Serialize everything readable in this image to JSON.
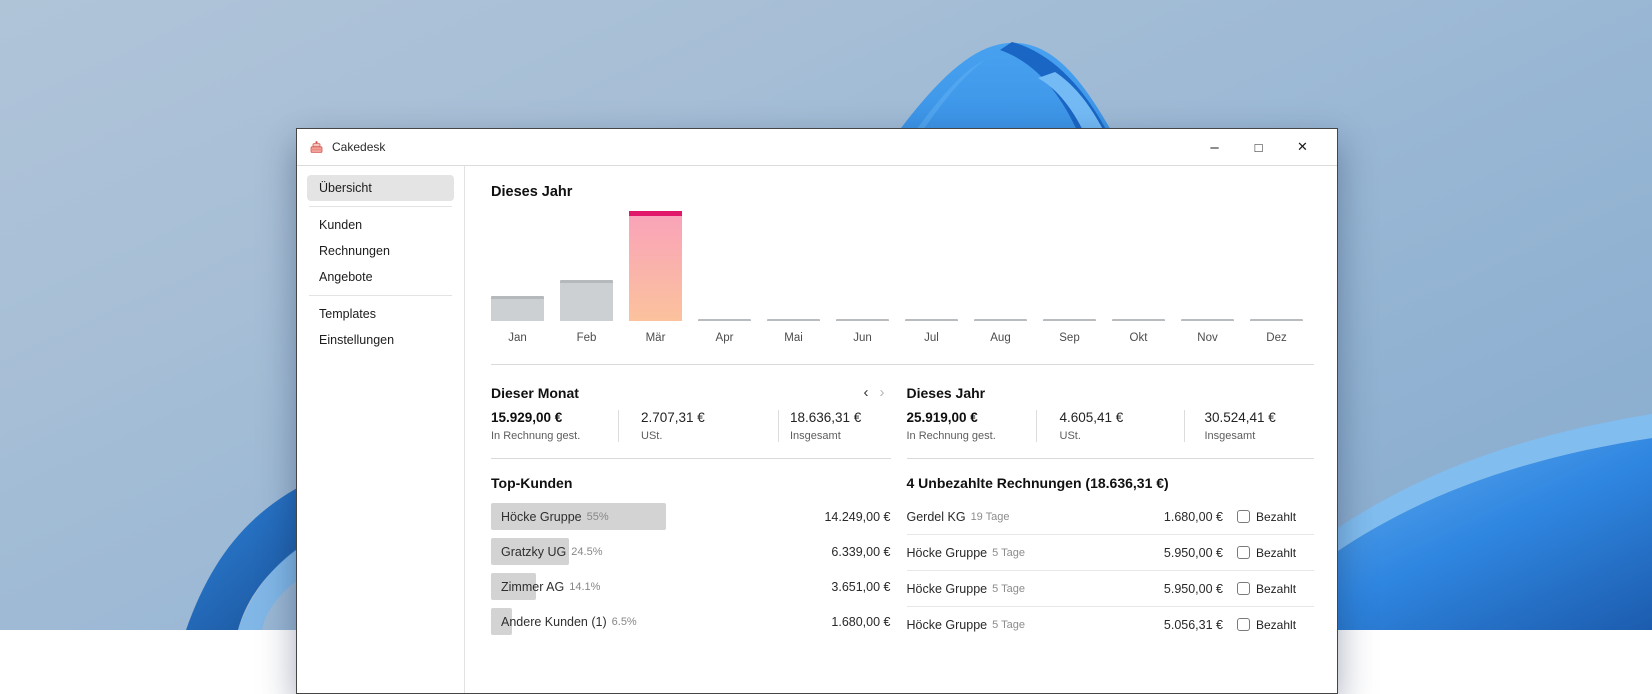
{
  "window": {
    "title": "Cakedesk",
    "controls": {
      "minimize": "–",
      "maximize": "□",
      "close": "✕"
    }
  },
  "sidebar": {
    "items": [
      {
        "label": "Übersicht",
        "active": true
      },
      {
        "label": "Kunden",
        "active": false
      },
      {
        "label": "Rechnungen",
        "active": false
      },
      {
        "label": "Angebote",
        "active": false
      },
      {
        "label": "Templates",
        "active": false
      },
      {
        "label": "Einstellungen",
        "active": false
      }
    ]
  },
  "chart_data": {
    "type": "bar",
    "title": "Dieses Jahr",
    "categories": [
      "Jan",
      "Feb",
      "Mär",
      "Apr",
      "Mai",
      "Jun",
      "Jul",
      "Aug",
      "Sep",
      "Okt",
      "Nov",
      "Dez"
    ],
    "values": [
      3600,
      5900,
      15929,
      0,
      0,
      0,
      0,
      0,
      0,
      0,
      0,
      0
    ],
    "values_estimated_from_bar_heights": true,
    "unit": "€",
    "highlight_category": "Mär",
    "ylim": [
      0,
      15929
    ],
    "grid": false,
    "bar_color_default": "#cdd0d3",
    "highlight_cap_color": "#e0176b",
    "highlight_gradient": [
      "#f9a2ba",
      "#fbc29d"
    ]
  },
  "stats": {
    "nav": {
      "prev": "‹",
      "next": "›"
    },
    "month": {
      "title": "Dieser Monat",
      "items": [
        {
          "value": "15.929,00 €",
          "label": "In Rechnung gest."
        },
        {
          "value": "2.707,31 €",
          "label": "USt."
        },
        {
          "value": "18.636,31 €",
          "label": "Insgesamt"
        }
      ]
    },
    "year": {
      "title": "Dieses Jahr",
      "items": [
        {
          "value": "25.919,00 €",
          "label": "In Rechnung gest."
        },
        {
          "value": "4.605,41 €",
          "label": "USt."
        },
        {
          "value": "30.524,41 €",
          "label": "Insgesamt"
        }
      ]
    }
  },
  "top_customers": {
    "title": "Top-Kunden",
    "rows": [
      {
        "name": "Höcke Gruppe",
        "percent": "55%",
        "percent_value": 55,
        "amount": "14.249,00 €"
      },
      {
        "name": "Gratzky UG",
        "percent": "24.5%",
        "percent_value": 24.5,
        "amount": "6.339,00 €"
      },
      {
        "name": "Zimmer AG",
        "percent": "14.1%",
        "percent_value": 14.1,
        "amount": "3.651,00 €"
      },
      {
        "name": "Andere Kunden (1)",
        "percent": "6.5%",
        "percent_value": 6.5,
        "amount": "1.680,00 €"
      }
    ]
  },
  "unpaid_invoices": {
    "title": "4 Unbezahlte Rechnungen (18.636,31 €)",
    "checkbox_label": "Bezahlt",
    "rows": [
      {
        "name": "Gerdel KG",
        "age": "19 Tage",
        "amount": "1.680,00 €",
        "paid": false
      },
      {
        "name": "Höcke Gruppe",
        "age": "5 Tage",
        "amount": "5.950,00 €",
        "paid": false
      },
      {
        "name": "Höcke Gruppe",
        "age": "5 Tage",
        "amount": "5.950,00 €",
        "paid": false
      },
      {
        "name": "Höcke Gruppe",
        "age": "5 Tage",
        "amount": "5.056,31 €",
        "paid": false
      }
    ]
  },
  "colors": {
    "accent_pink": "#e0176b",
    "bar_gray": "#cdd0d3",
    "customer_bar_gray": "#d3d3d4",
    "sidebar_active_bg": "#e4e4e4",
    "wallpaper_blue": "#2f86e0"
  }
}
